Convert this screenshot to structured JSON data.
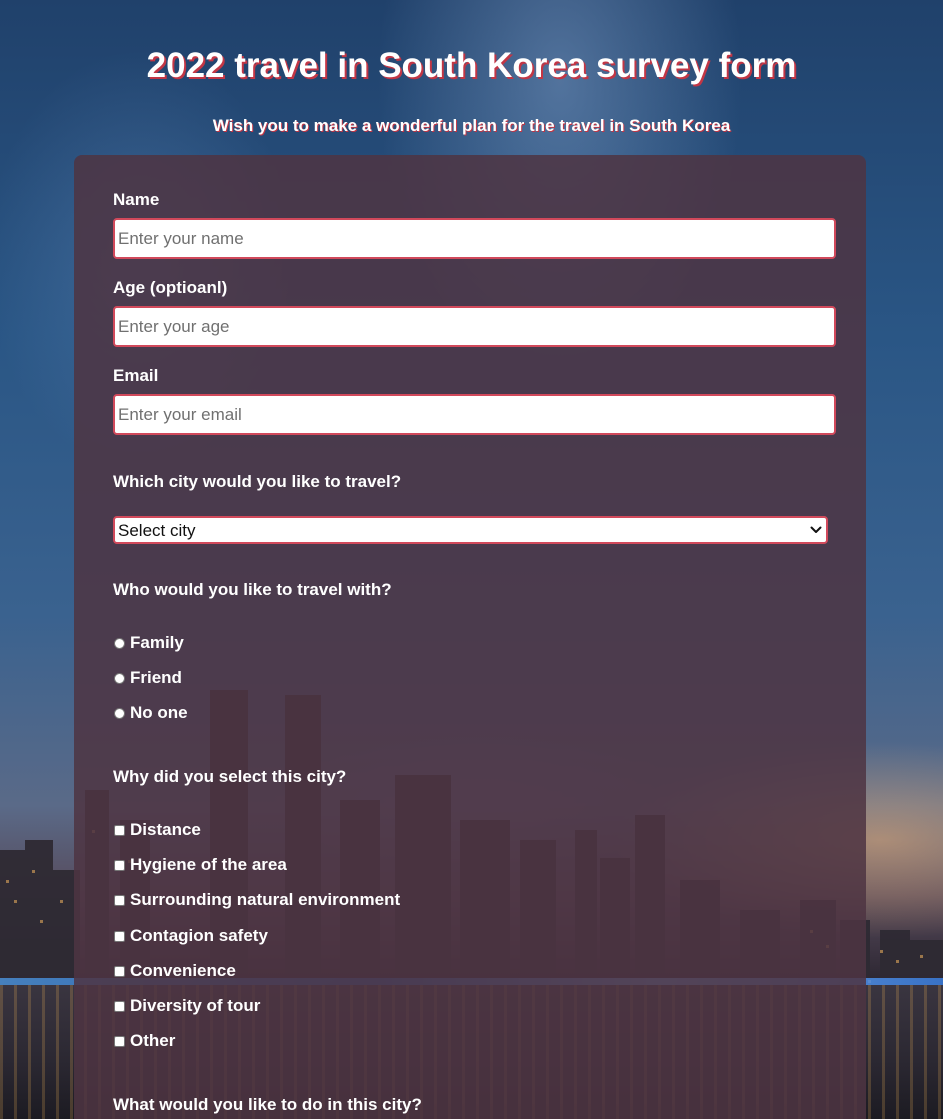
{
  "page": {
    "title": "2022 travel in South Korea survey form",
    "subtitle": "Wish you to make a wonderful plan for the travel in South Korea"
  },
  "form": {
    "name": {
      "label": "Name",
      "placeholder": "Enter your name",
      "value": ""
    },
    "age": {
      "label": "Age (optioanl)",
      "placeholder": "Enter your age",
      "value": ""
    },
    "email": {
      "label": "Email",
      "placeholder": "Enter your email",
      "value": ""
    },
    "city": {
      "question": "Which city would you like to travel?",
      "selected": "Select city"
    },
    "companion": {
      "question": "Who would you like to travel with?",
      "options": [
        "Family",
        "Friend",
        "No one"
      ]
    },
    "reasons": {
      "question": "Why did you select this city?",
      "options": [
        "Distance",
        "Hygiene of the area",
        "Surrounding natural environment",
        "Contagion safety",
        "Convenience",
        "Diversity of tour",
        "Other"
      ]
    },
    "activities": {
      "question": "What would you like to do in this city?"
    }
  },
  "colors": {
    "accent": "#d1495b",
    "title_shadow": "#c23645",
    "card": "#4e3442"
  },
  "icons": {
    "select_arrow": "chevron-down-icon"
  }
}
